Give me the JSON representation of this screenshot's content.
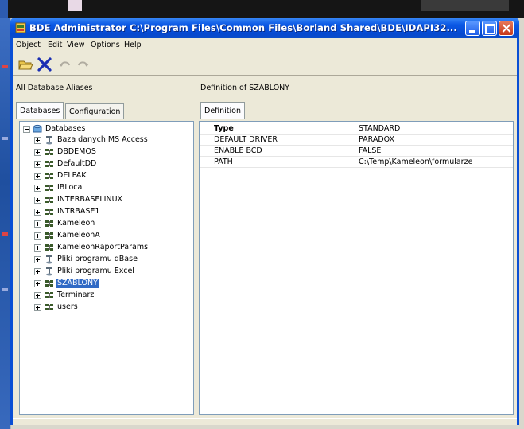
{
  "window": {
    "title": "BDE Administrator  C:\\Program Files\\Common Files\\Borland Shared\\BDE\\IDAPI32...",
    "accent_color": "#0a4fd4"
  },
  "menu": [
    "Object",
    "Edit",
    "View",
    "Options",
    "Help"
  ],
  "toolbar": {
    "buttons": [
      {
        "name": "open-icon"
      },
      {
        "name": "delete-icon"
      },
      {
        "name": "undo-icon"
      },
      {
        "name": "redo-icon"
      }
    ]
  },
  "left_panel": {
    "header": "All Database Aliases",
    "tabs": [
      "Databases",
      "Configuration"
    ],
    "tree": {
      "root": "Databases",
      "items": [
        {
          "label": "Baza danych MS Access",
          "icon": "odbc-icon"
        },
        {
          "label": "DBDEMOS",
          "icon": "database-icon"
        },
        {
          "label": "DefaultDD",
          "icon": "database-icon"
        },
        {
          "label": "DELPAK",
          "icon": "database-icon"
        },
        {
          "label": "IBLocal",
          "icon": "database-icon"
        },
        {
          "label": "INTERBASELINUX",
          "icon": "database-icon"
        },
        {
          "label": "INTRBASE1",
          "icon": "database-icon"
        },
        {
          "label": "Kameleon",
          "icon": "database-icon"
        },
        {
          "label": "KameleonA",
          "icon": "database-icon"
        },
        {
          "label": "KameleonRaportParams",
          "icon": "database-icon"
        },
        {
          "label": "Pliki programu dBase",
          "icon": "odbc-icon"
        },
        {
          "label": "Pliki programu Excel",
          "icon": "odbc-icon"
        },
        {
          "label": "SZABLONY",
          "icon": "database-icon",
          "selected": true
        },
        {
          "label": "Terminarz",
          "icon": "database-icon"
        },
        {
          "label": "users",
          "icon": "database-icon"
        }
      ]
    }
  },
  "right_panel": {
    "header": "Definition of SZABLONY",
    "tab": "Definition",
    "rows": [
      {
        "key": "Type",
        "value": "STANDARD",
        "bold": true
      },
      {
        "key": "DEFAULT DRIVER",
        "value": "PARADOX"
      },
      {
        "key": "ENABLE BCD",
        "value": "FALSE"
      },
      {
        "key": "PATH",
        "value": "C:\\Temp\\Kameleon\\formularze"
      }
    ]
  }
}
